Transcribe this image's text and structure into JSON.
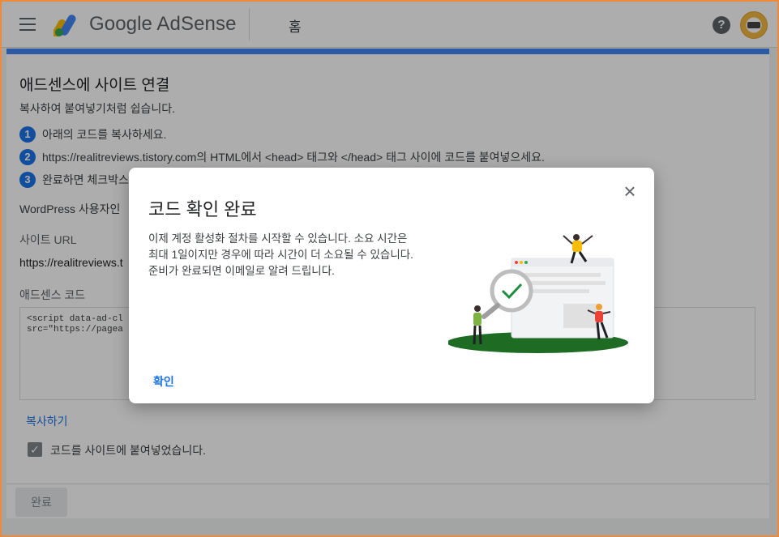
{
  "header": {
    "brand": "Google AdSense",
    "page_title": "홈",
    "help_label": "?"
  },
  "main": {
    "title": "애드센스에 사이트 연결",
    "subtitle": "복사하여 붙여넣기처럼 쉽습니다.",
    "steps": [
      {
        "num": "1",
        "text": "아래의 코드를 복사하세요."
      },
      {
        "num": "2",
        "text": "https://realitreviews.tistory.com의 HTML에서 <head> 태그와 </head> 태그 사이에 코드를 붙여넣으세요."
      },
      {
        "num": "3",
        "text": "완료하면 체크박스"
      }
    ],
    "wordpress_note": "WordPress 사용자인",
    "site_url_label": "사이트 URL",
    "site_url_value": "https://realitreviews.t",
    "code_label": "애드센스 코드",
    "code_text": "<script data-ad-cl\nsrc=\"https://pagea",
    "copy_label": "복사하기",
    "checkbox_label": "코드를 사이트에 붙여넣었습니다.",
    "checkbox_checked": true,
    "done_label": "완료"
  },
  "dialog": {
    "title": "코드 확인 완료",
    "body_lines": [
      "이제 계정 활성화 절차를 시작할 수 있습니다. 소요 시간은",
      "최대 1일이지만 경우에 따라 시간이 더 소요될 수 있습니다.",
      "준비가 완료되면 이메일로 알려 드립니다."
    ],
    "confirm_label": "확인"
  },
  "colors": {
    "accent": "#4285f4",
    "link": "#1a73e8",
    "frame": "#ef8a3a",
    "ground": "#1e6b23"
  }
}
